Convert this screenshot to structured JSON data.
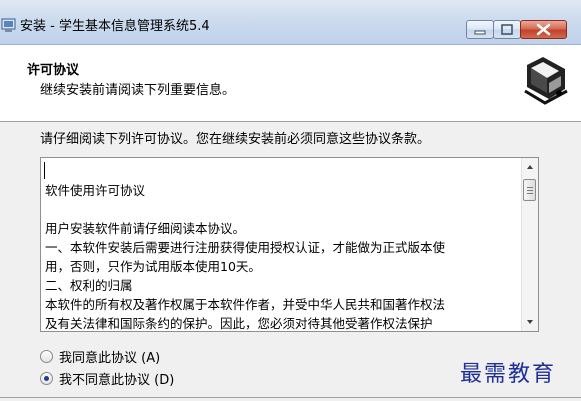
{
  "window": {
    "title": "安装 - 学生基本信息管理系统5.4"
  },
  "header": {
    "title": "许可协议",
    "subtitle": "继续安装前请阅读下列重要信息。"
  },
  "instruction": "请仔细阅读下列许可协议。您在继续安装前必须同意这些协议条款。",
  "license": {
    "lines": [
      "",
      "软件使用许可协议",
      "",
      "用户安装软件前请仔细阅读本协议。",
      "一、本软件安装后需要进行注册获得使用授权认证，才能做为正式版本使",
      "用，否则，只作为试用版本使用10天。",
      "二、权利的归属",
      "本软件的所有权及著作权属于本软件作者，并受中华人民共和国著作权法",
      "及有关法律和国际条约的保护。因此，您必须对待其他受著作权法保护"
    ]
  },
  "options": {
    "accept_label": "我同意此协议 (A)",
    "decline_label": "我不同意此协议 (D)",
    "selected": "decline"
  },
  "watermark": "最需教育",
  "icons": {
    "app": "installer-app-icon",
    "header_logo": "installer-computer-icon"
  }
}
